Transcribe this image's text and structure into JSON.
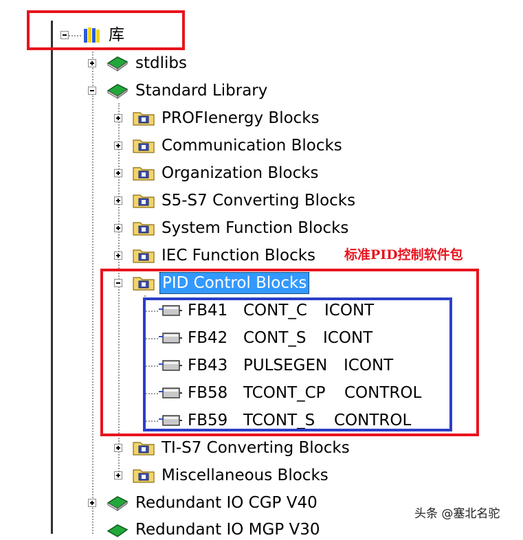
{
  "root": {
    "label": "库"
  },
  "tree": {
    "stdlibs": "stdlibs",
    "standard_library": "Standard Library",
    "folders": [
      "PROFIenergy Blocks",
      "Communication Blocks",
      "Organization Blocks",
      "S5-S7 Converting Blocks",
      "System Function Blocks",
      "IEC Function Blocks"
    ],
    "pid_folder": "PID Control Blocks",
    "blocks": [
      {
        "number": "FB41",
        "name": "CONT_C",
        "family": "ICONT"
      },
      {
        "number": "FB42",
        "name": "CONT_S",
        "family": "ICONT"
      },
      {
        "number": "FB43",
        "name": "PULSEGEN",
        "family": "ICONT"
      },
      {
        "number": "FB58",
        "name": "TCONT_CP",
        "family": "CONTROL"
      },
      {
        "number": "FB59",
        "name": "TCONT_S",
        "family": "CONTROL"
      }
    ],
    "after_folders": [
      "TI-S7 Converting Blocks",
      "Miscellaneous Blocks"
    ],
    "redundant": "Redundant IO CGP V40",
    "redundant_cut": "Redundant IO MGP V30"
  },
  "annotation": "标准PID控制软件包",
  "watermark": "头条 @塞北名驼",
  "colors": {
    "highlight_red": "#e8141e",
    "highlight_blue": "#2b3fc8",
    "annotation_red": "#e8141e",
    "selection": "#3399ff"
  },
  "icons": {
    "root": "library-books-icon",
    "library": "green-book-icon",
    "folder": "block-folder-icon",
    "block": "function-block-icon"
  }
}
